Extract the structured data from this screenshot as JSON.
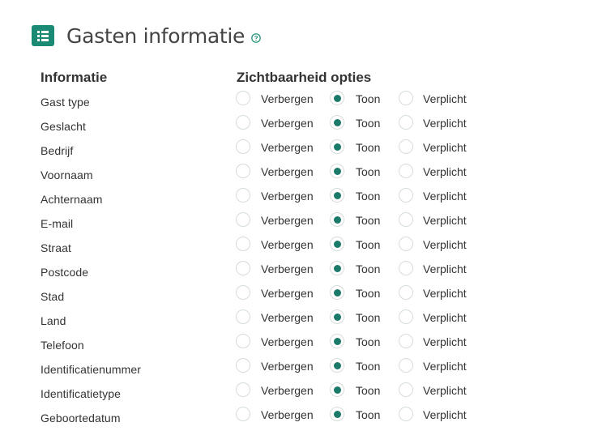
{
  "header": {
    "title": "Gasten informatie",
    "icon": "list-icon",
    "help_icon": "help-circle-icon",
    "accent_color": "#1b8a74"
  },
  "columns": {
    "info": "Informatie",
    "visibility": "Zichtbaarheid opties"
  },
  "options": [
    "Verbergen",
    "Toon",
    "Verplicht"
  ],
  "fields": [
    {
      "label": "Gast type",
      "selected": "Toon"
    },
    {
      "label": "Geslacht",
      "selected": "Toon"
    },
    {
      "label": "Bedrijf",
      "selected": "Toon"
    },
    {
      "label": "Voornaam",
      "selected": "Toon"
    },
    {
      "label": "Achternaam",
      "selected": "Toon"
    },
    {
      "label": "E-mail",
      "selected": "Toon"
    },
    {
      "label": "Straat",
      "selected": "Toon"
    },
    {
      "label": "Postcode",
      "selected": "Toon"
    },
    {
      "label": "Stad",
      "selected": "Toon"
    },
    {
      "label": "Land",
      "selected": "Toon"
    },
    {
      "label": "Telefoon",
      "selected": "Toon"
    },
    {
      "label": "Identificatienummer",
      "selected": "Toon"
    },
    {
      "label": "Identificatietype",
      "selected": "Toon"
    },
    {
      "label": "Geboortedatum",
      "selected": "Toon"
    }
  ]
}
